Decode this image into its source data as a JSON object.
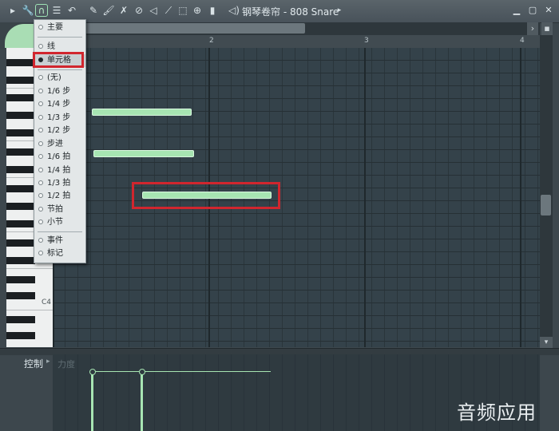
{
  "window": {
    "title": "钢琴卷帘 - 808 Snare",
    "accent": "#9ee3b5",
    "note_color": "#a7e5b2",
    "highlight_color": "#d1262e"
  },
  "toolbar": {
    "icons": [
      "play-triangle-icon",
      "wrench-icon",
      "magnet-snap-icon",
      "menu-list-icon",
      "undo-icon",
      "pencil-icon",
      "paintbrush-icon",
      "delete-brush-icon",
      "no-entry-icon",
      "mute-icon",
      "slice-icon",
      "select-icon",
      "zoom-icon",
      "speaker-icon"
    ]
  },
  "ruler": {
    "bars": [
      "2",
      "3",
      "4"
    ]
  },
  "snap_menu": {
    "items": [
      {
        "label": "主要",
        "selected": false
      },
      {
        "label": "线",
        "selected": false
      },
      {
        "label": "单元格",
        "selected": true
      },
      {
        "label": "(无)",
        "selected": false
      },
      {
        "label": "1/6 步",
        "selected": false
      },
      {
        "label": "1/4 步",
        "selected": false
      },
      {
        "label": "1/3 步",
        "selected": false
      },
      {
        "label": "1/2 步",
        "selected": false
      },
      {
        "label": "步进",
        "selected": false
      },
      {
        "label": "1/6 拍",
        "selected": false
      },
      {
        "label": "1/4 拍",
        "selected": false
      },
      {
        "label": "1/3 拍",
        "selected": false
      },
      {
        "label": "1/2 拍",
        "selected": false
      },
      {
        "label": "节拍",
        "selected": false
      },
      {
        "label": "小节",
        "selected": false
      },
      {
        "label": "事件",
        "selected": false
      },
      {
        "label": "标记",
        "selected": false
      }
    ]
  },
  "keyboard": {
    "c4_label": "C4"
  },
  "control": {
    "label": "控制",
    "parameter": "力度"
  },
  "watermark": "音频应用"
}
